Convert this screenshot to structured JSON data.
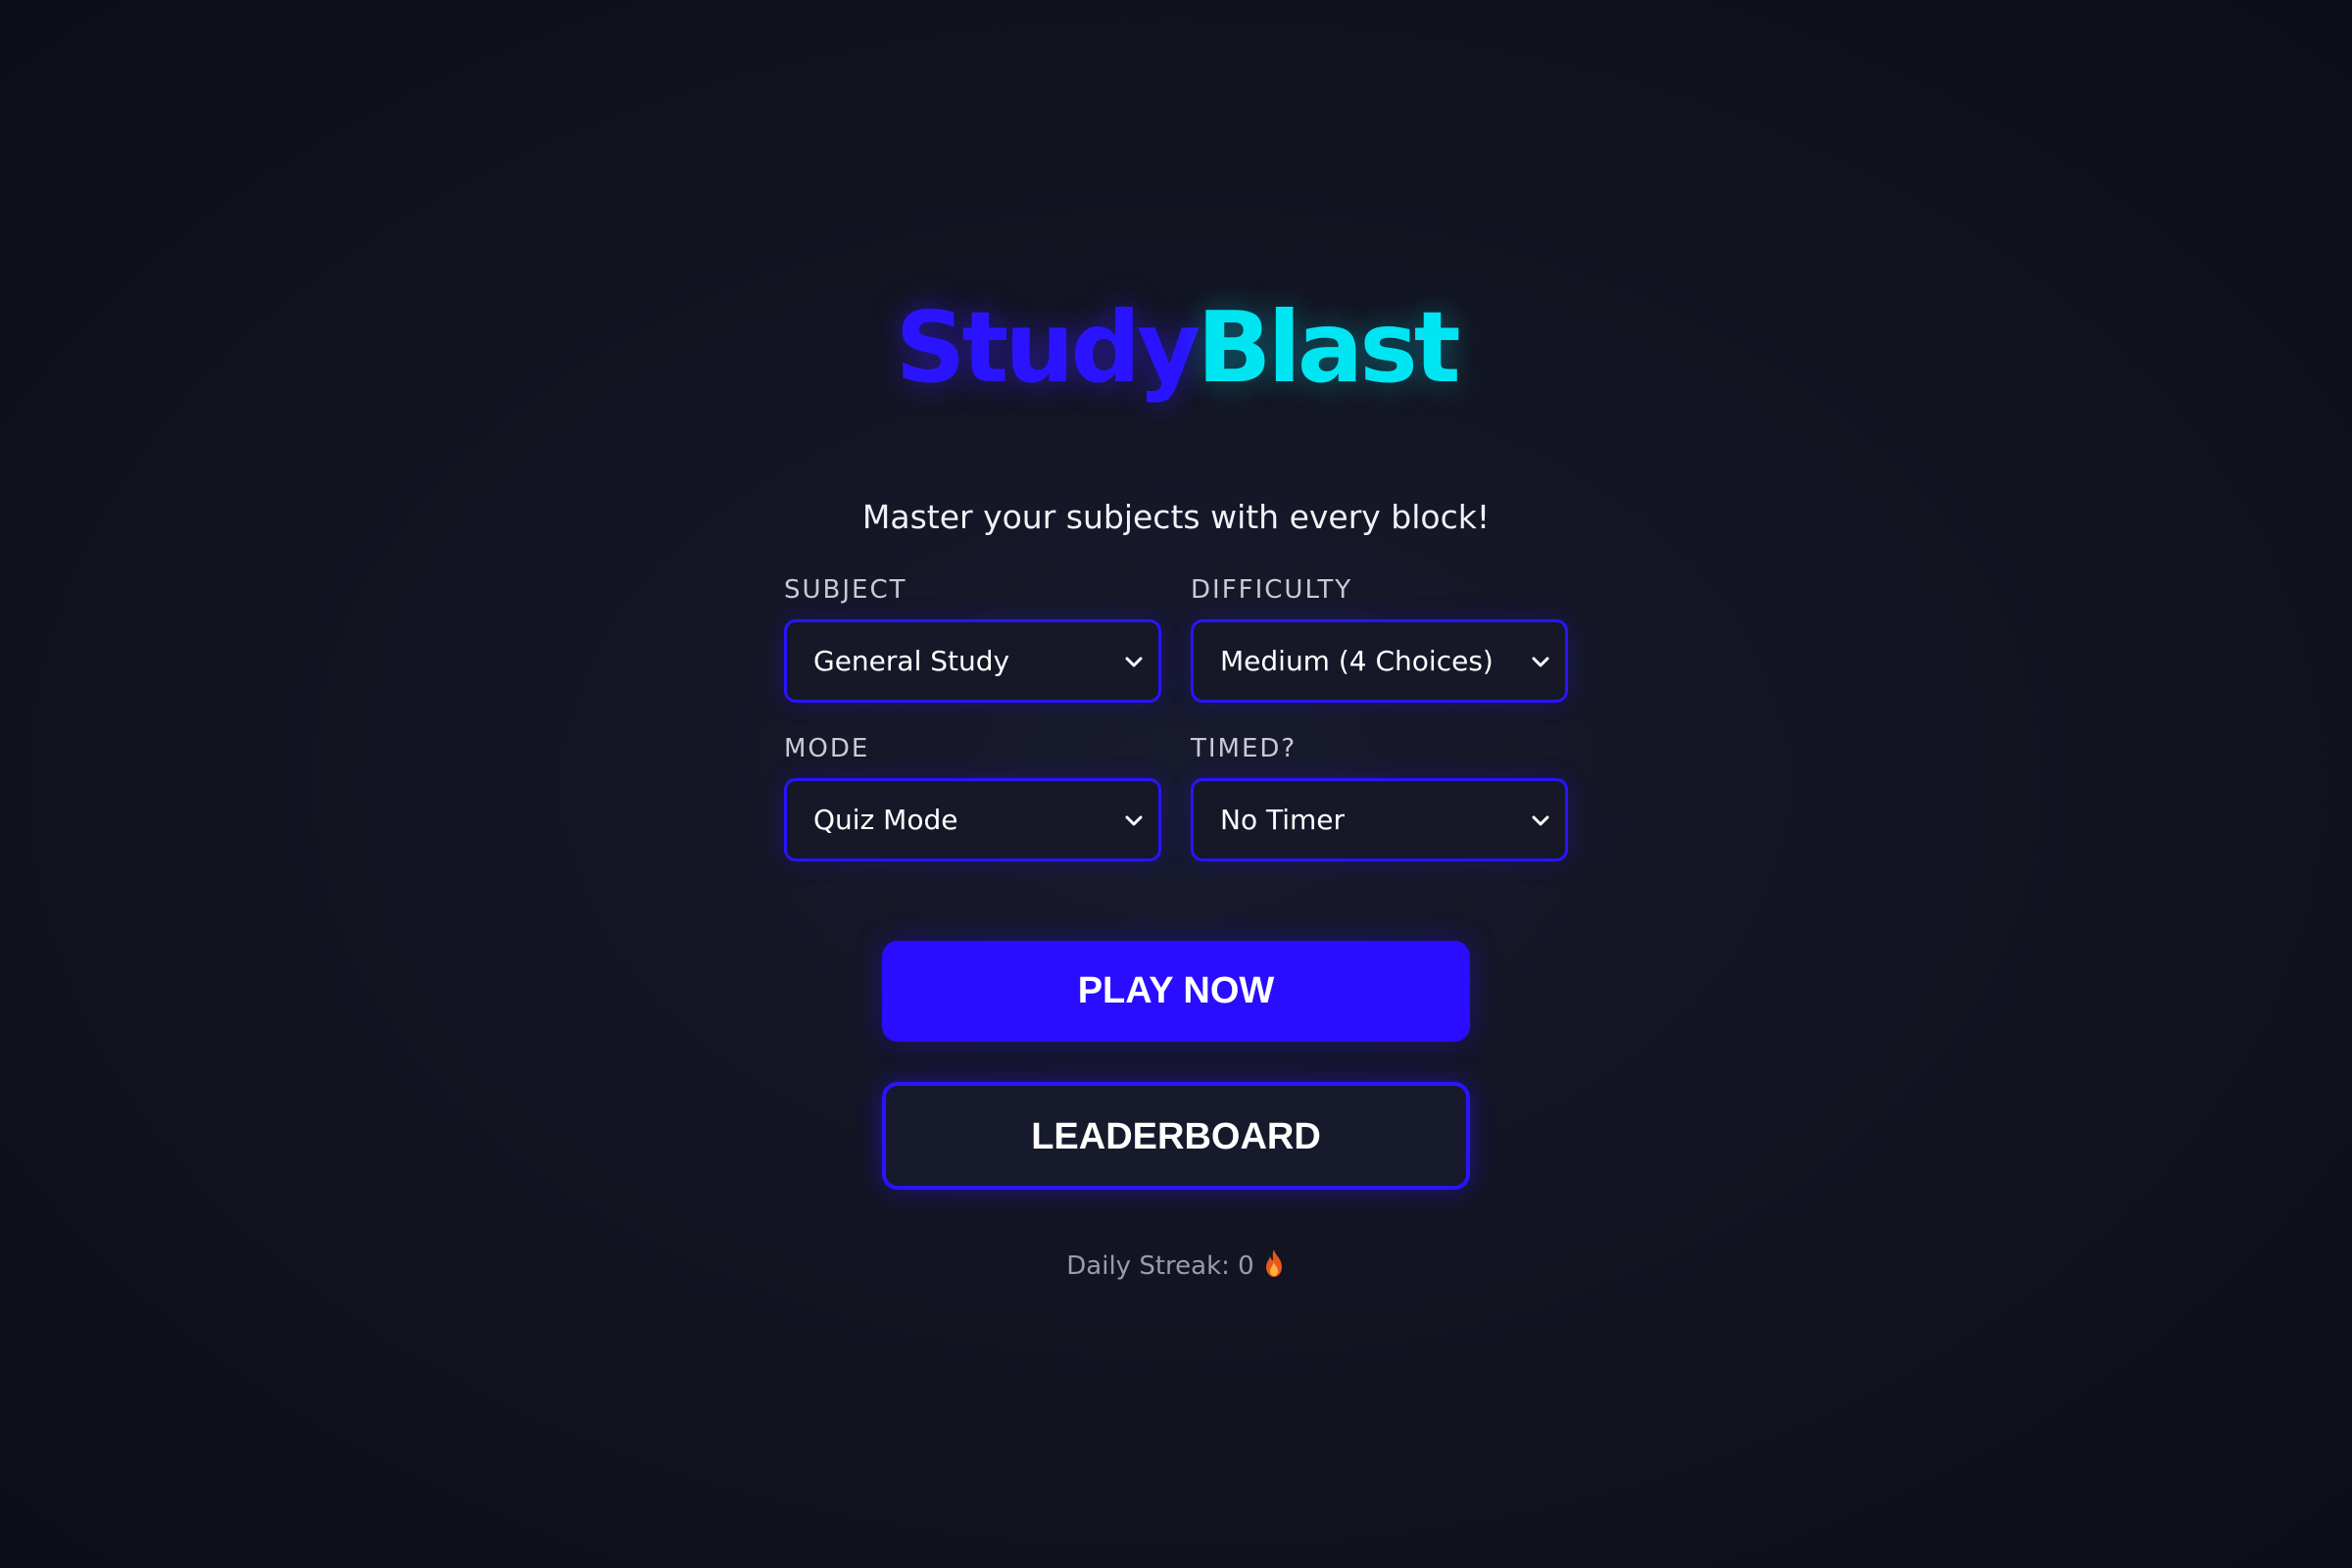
{
  "logo": {
    "part1": "Study",
    "part2": "Blast"
  },
  "tagline": "Master your subjects with every block!",
  "fields": {
    "subject": {
      "label": "SUBJECT",
      "value": "General Study"
    },
    "difficulty": {
      "label": "DIFFICULTY",
      "value": "Medium (4 Choices)"
    },
    "mode": {
      "label": "MODE",
      "value": "Quiz Mode"
    },
    "timed": {
      "label": "TIMED?",
      "value": "No Timer"
    }
  },
  "buttons": {
    "play": "PLAY NOW",
    "leaderboard": "LEADERBOARD"
  },
  "streak": {
    "label": "Daily Streak: 0",
    "icon": "flame-icon"
  },
  "colors": {
    "primary": "#2a0dff",
    "accent": "#00e5f2",
    "background": "#12131f"
  }
}
